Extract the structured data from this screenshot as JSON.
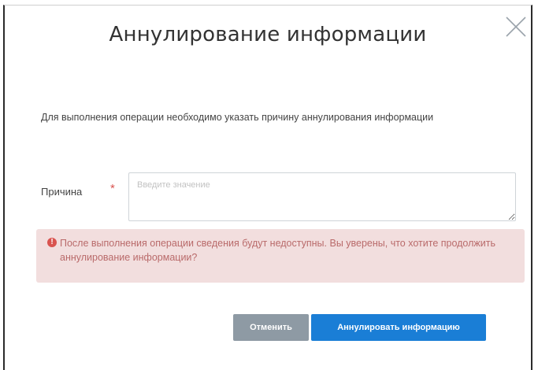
{
  "dialog": {
    "title": "Аннулирование информации",
    "description": "Для выполнения операции необходимо указать причину аннулирования информации",
    "reason": {
      "label": "Причина",
      "required_mark": "*",
      "placeholder": "Введите значение",
      "value": ""
    },
    "alert": {
      "icon": "exclamation-circle-icon",
      "text": "После выполнения операции сведения будут недоступны. Вы уверены, что хотите продолжить аннулирование информации?"
    },
    "buttons": {
      "cancel": "Отменить",
      "annul": "Аннулировать информацию"
    },
    "close_icon": "close-icon"
  },
  "colors": {
    "primary_button": "#1a7ed6",
    "secondary_button": "#8e9aa4",
    "alert_background": "#f2dede",
    "alert_text": "#b96a6a",
    "required": "#d9534f"
  }
}
